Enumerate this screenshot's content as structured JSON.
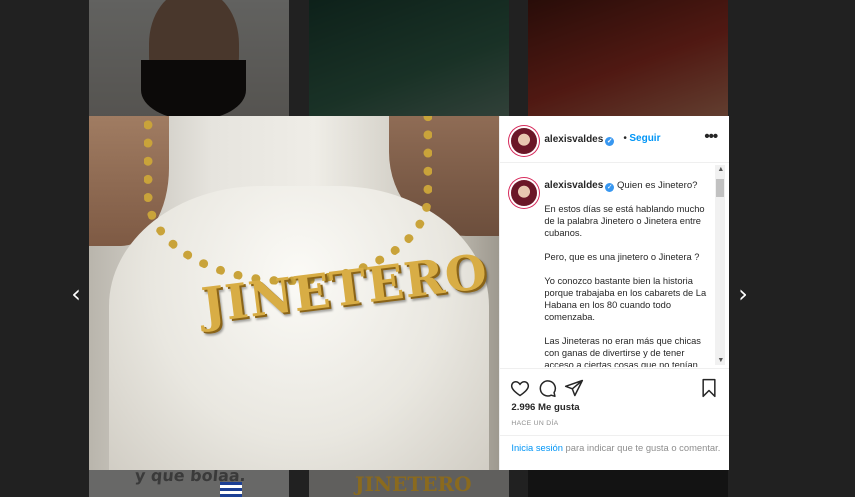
{
  "background": {
    "caption_left": "y que bolaa.",
    "caption_mid": "JINETERO"
  },
  "navigation": {
    "prev_icon": "chevron-left-icon",
    "next_icon": "chevron-right-icon"
  },
  "photo": {
    "pendant_text": "JINETERO"
  },
  "post": {
    "header": {
      "username": "alexisvaldes",
      "separator": "•",
      "follow_label": "Seguir",
      "more_label": "•••"
    },
    "caption": {
      "username": "alexisvaldes",
      "first_line": "Quien es Jinetero?",
      "paragraphs": [
        "En estos días se está hablando mucho de la palabra Jinetero o Jinetera entre cubanos.",
        "Pero, que es una jinetero o Jinetera ?",
        "Yo conozco bastante bien la historia porque trabajaba en los cabarets de La Habana en los 80 cuando todo comenzaba.",
        "Las Jineteras no eran más que chicas con ganas de divertirse y de tener acceso a ciertas cosas que no tenían"
      ]
    },
    "likes": "2.996 Me gusta",
    "time": "HACE UN DÍA",
    "login": {
      "link": "Inicia sesión",
      "rest": " para indicar que te gusta o comentar."
    },
    "icons": {
      "like": "heart-icon",
      "comment": "comment-icon",
      "share": "share-icon",
      "save": "bookmark-icon",
      "verified": "verified-badge-icon"
    },
    "colors": {
      "link": "#0095f6",
      "verified": "#3897f0",
      "muted": "#8e8e8e"
    }
  }
}
